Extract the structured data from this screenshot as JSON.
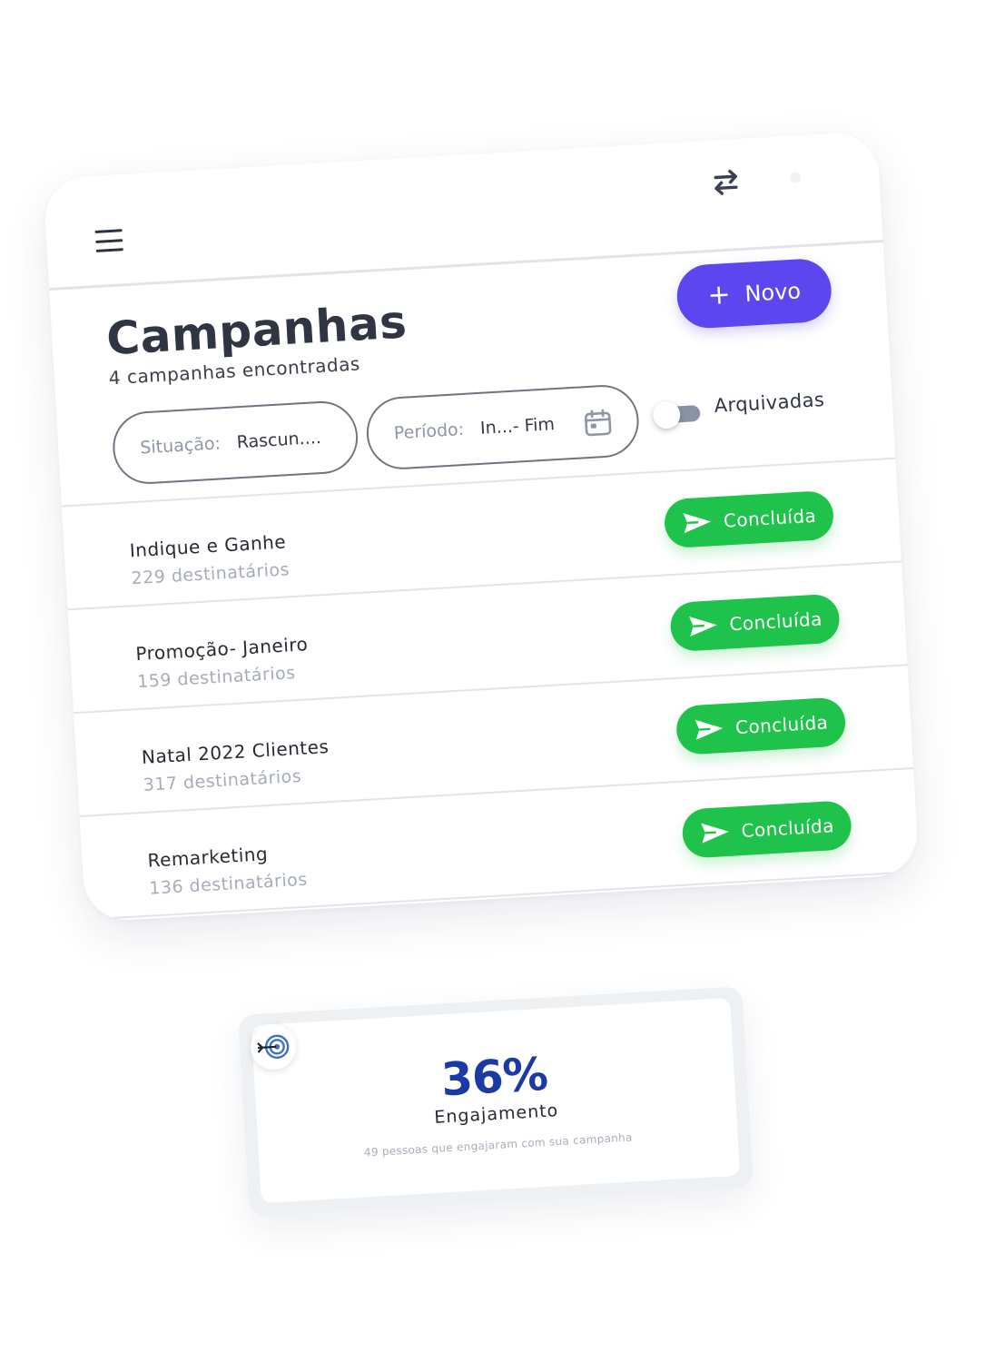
{
  "header": {
    "menu_icon": "hamburger-menu-icon",
    "swap_icon": "swap-arrows-icon"
  },
  "page": {
    "title": "Campanhas",
    "subtitle": "4 campanhas encontradas",
    "new_button_label": "Novo"
  },
  "filters": {
    "situation_label": "Situação:",
    "situation_value": "Rascun....",
    "period_label": "Período:",
    "period_value": "In...- Fim",
    "archived_label": "Arquivadas",
    "archived_enabled": false
  },
  "campaigns": [
    {
      "name": "Indique e Ganhe",
      "count": "229 destinatários",
      "status": "Concluída"
    },
    {
      "name": "Promoção- Janeiro",
      "count": "159  destinatários",
      "status": "Concluída"
    },
    {
      "name": "Natal 2022 Clientes",
      "count": "317  destinatários",
      "status": "Concluída"
    },
    {
      "name": "Remarketing",
      "count": "136  destinatários",
      "status": "Concluída"
    }
  ],
  "engagement": {
    "value": "36%",
    "label": "Engajamento",
    "description": "49 pessoas que engajaram com sua campanha"
  },
  "colors": {
    "primary": "#5b46f0",
    "success": "#1fc24a",
    "engagement_value": "#1b3aa6",
    "text_dark": "#2f3542",
    "text_muted": "#a6acba"
  }
}
